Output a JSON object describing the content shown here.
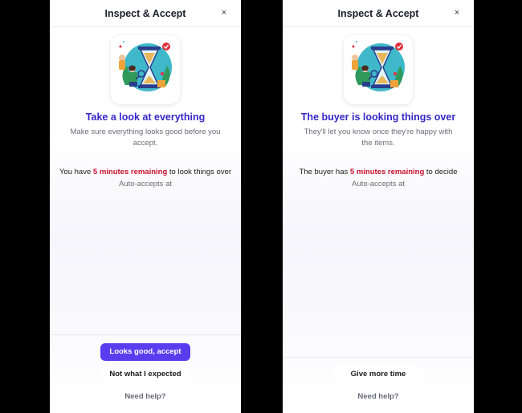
{
  "left_panel": {
    "title": "Inspect & Accept",
    "close_symbol": "×",
    "heading": "Take a look at everything",
    "subtext": "Make sure everything looks good before you accept.",
    "timer": {
      "prefix": "You have ",
      "highlight": "5 minutes remaining",
      "suffix": " to look things over"
    },
    "auto_accept_label": "Auto-accepts at",
    "primary_button": "Looks good, accept",
    "secondary_button": "Not what I expected",
    "help_link": "Need help?"
  },
  "right_panel": {
    "title": "Inspect & Accept",
    "close_symbol": "×",
    "heading": "The buyer is looking things over",
    "subtext": "They'll let you know once they're happy with the items.",
    "timer": {
      "prefix": "The buyer has ",
      "highlight": "5 minutes remaining",
      "suffix": " to decide"
    },
    "auto_accept_label": "Auto-accepts at",
    "secondary_button": "Give more time",
    "help_link": "Need help?"
  },
  "icons": {
    "close": "close-icon",
    "illustration": "hourglass-inspection-illustration"
  },
  "colors": {
    "accent_heading": "#3527c8",
    "primary_button": "#5b3df0",
    "timer_highlight": "#c8102e"
  }
}
